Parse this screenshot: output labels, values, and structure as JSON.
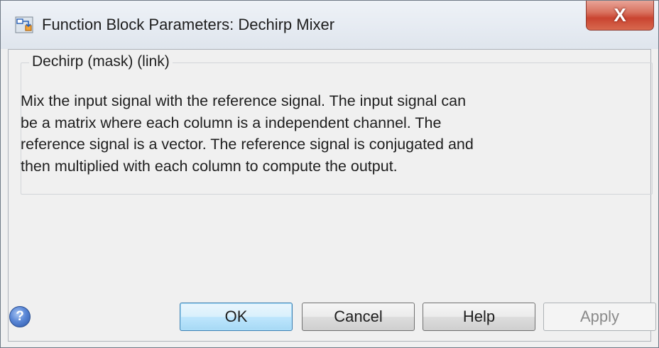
{
  "window": {
    "title": "Function Block Parameters: Dechirp Mixer",
    "close_glyph": "X",
    "icon": "simulink-block-icon"
  },
  "group": {
    "legend": "Dechirp (mask) (link)",
    "description_lines": [
      "Mix the input signal with the reference signal. The input signal can",
      "be a matrix where each column is a independent channel. The",
      "reference signal is a vector. The reference signal is conjugated and",
      "then multiplied with each column to compute the output."
    ]
  },
  "buttons": {
    "ok": "OK",
    "cancel": "Cancel",
    "help": "Help",
    "apply": "Apply",
    "apply_enabled": false
  },
  "help_icon": {
    "glyph": "?",
    "icon": "question-help-icon"
  },
  "colors": {
    "close_button": "#c94430",
    "default_button_border": "#3c7fb1",
    "dialog_background": "#f0f0f0"
  }
}
